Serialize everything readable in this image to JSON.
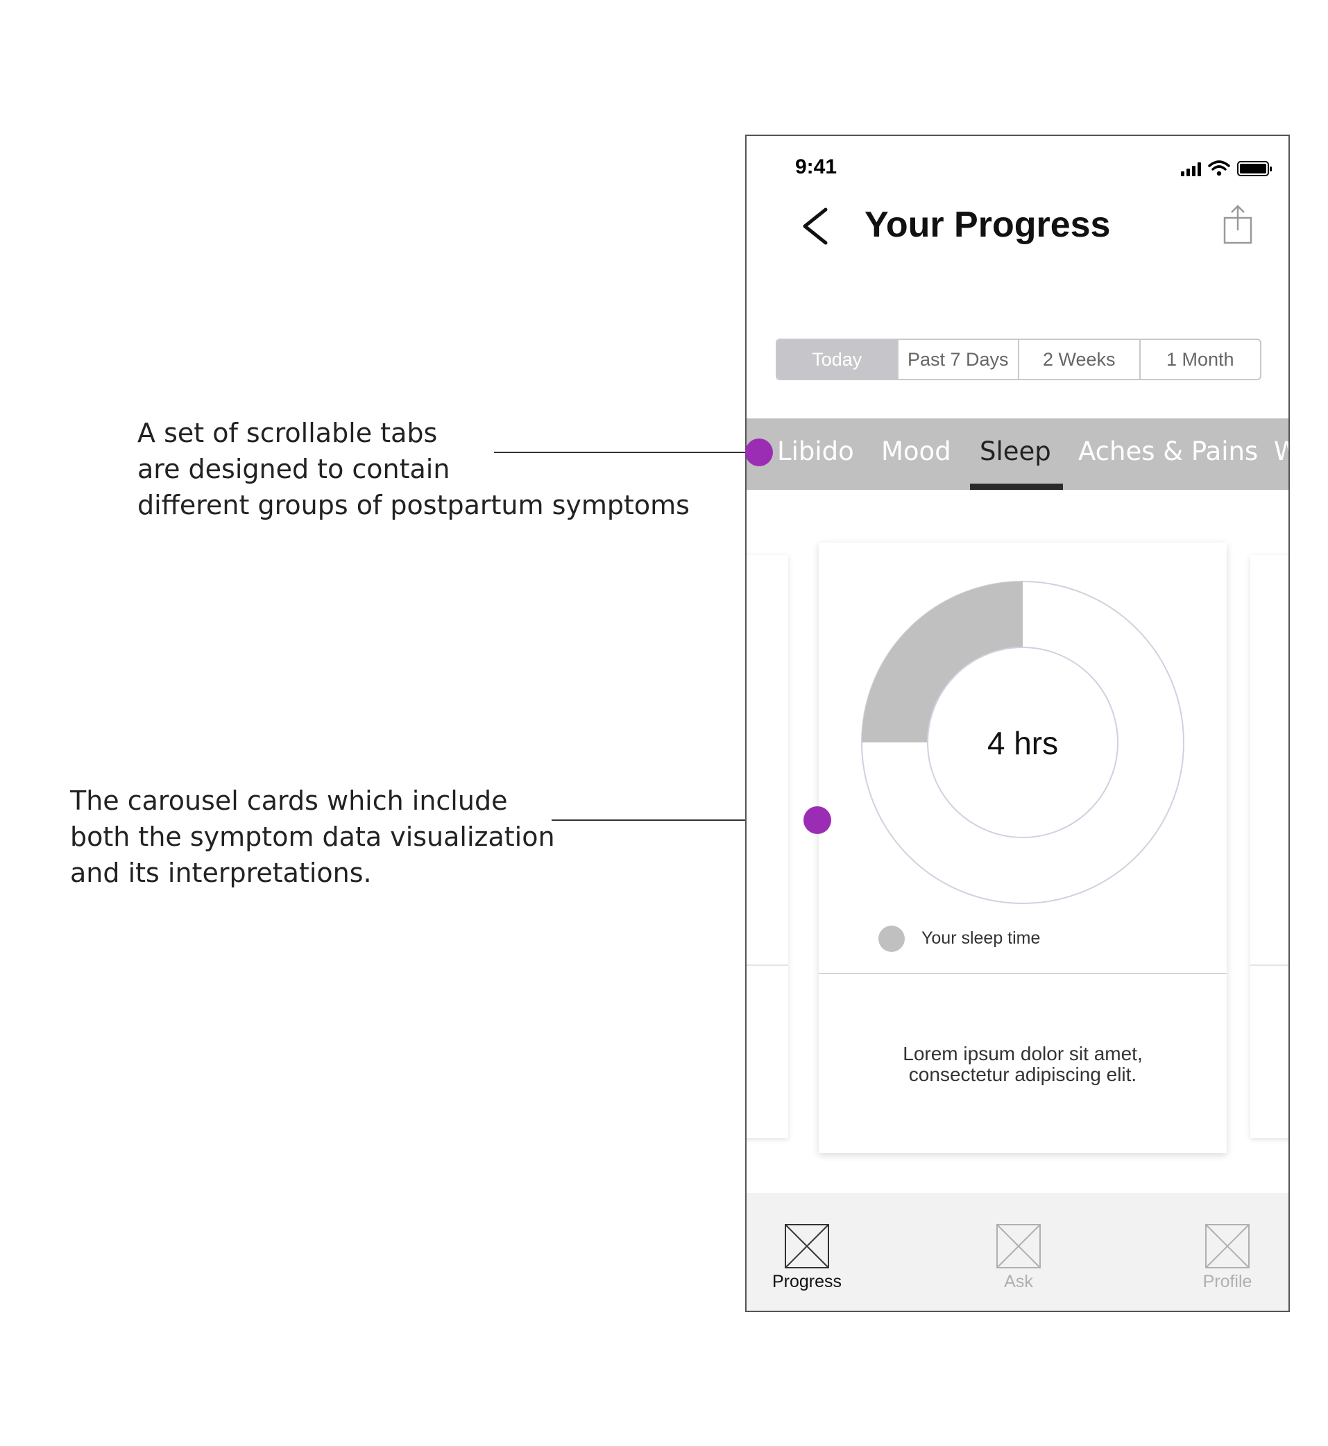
{
  "annotations": {
    "tabs_note": [
      "A set of scrollable tabs",
      "are designed to contain",
      "different groups of postpartum symptoms"
    ],
    "cards_note": [
      "The carousel cards which include",
      "both the symptom data visualization",
      "and its interpretations."
    ],
    "accent_color": "#9b2db5"
  },
  "status_bar": {
    "time": "9:41",
    "icons": [
      "signal-icon",
      "wifi-icon",
      "battery-icon"
    ]
  },
  "header": {
    "title": "Your Progress",
    "back_icon": "chevron-left-icon",
    "share_icon": "share-icon"
  },
  "range_tabs": [
    {
      "label": "Today",
      "active": true
    },
    {
      "label": "Past 7 Days",
      "active": false
    },
    {
      "label": "2 Weeks",
      "active": false
    },
    {
      "label": "1 Month",
      "active": false
    }
  ],
  "symptom_tabs": [
    {
      "label": "Libido",
      "active": false
    },
    {
      "label": "Mood",
      "active": false
    },
    {
      "label": "Sleep",
      "active": true
    },
    {
      "label": "Aches & Pains",
      "active": false
    },
    {
      "label": "W",
      "active": false
    }
  ],
  "card": {
    "chart_label": "4 hrs",
    "legend_label": "Your sleep time",
    "text_lines": [
      "Lorem ipsum dolor sit amet,",
      "consectetur adipiscing elit."
    ]
  },
  "chart_data": {
    "type": "pie",
    "slices": [
      {
        "name": "Your sleep time",
        "value": 4,
        "color": "#c0c0c0"
      },
      {
        "name": "",
        "value": 12,
        "color": "#ffffff"
      }
    ],
    "center_label": "4 hrs"
  },
  "bottom_nav": [
    {
      "label": "Progress",
      "icon": "image-placeholder-icon",
      "active": true
    },
    {
      "label": "Ask",
      "icon": "image-placeholder-icon",
      "active": false
    },
    {
      "label": "Profile",
      "icon": "image-placeholder-icon",
      "active": false
    }
  ]
}
